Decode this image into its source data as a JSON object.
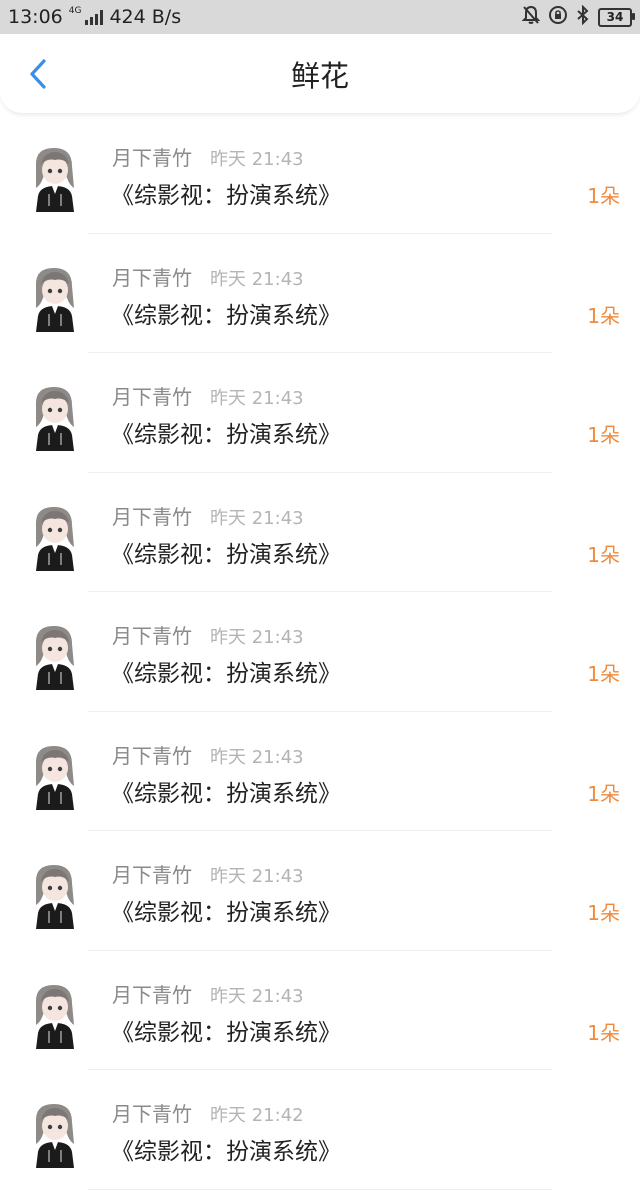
{
  "status_bar": {
    "time": "13:06",
    "network_tag": "4G",
    "speed": "424 B/s",
    "battery": "34"
  },
  "header": {
    "title": "鲜花"
  },
  "colors": {
    "accent_blue": "#3a8ee6",
    "amount_orange": "#f08a3e"
  },
  "records": [
    {
      "user": "月下青竹",
      "time": "昨天 21:43",
      "book": "《综影视：扮演系统》",
      "amount": "1朵"
    },
    {
      "user": "月下青竹",
      "time": "昨天 21:43",
      "book": "《综影视：扮演系统》",
      "amount": "1朵"
    },
    {
      "user": "月下青竹",
      "time": "昨天 21:43",
      "book": "《综影视：扮演系统》",
      "amount": "1朵"
    },
    {
      "user": "月下青竹",
      "time": "昨天 21:43",
      "book": "《综影视：扮演系统》",
      "amount": "1朵"
    },
    {
      "user": "月下青竹",
      "time": "昨天 21:43",
      "book": "《综影视：扮演系统》",
      "amount": "1朵"
    },
    {
      "user": "月下青竹",
      "time": "昨天 21:43",
      "book": "《综影视：扮演系统》",
      "amount": "1朵"
    },
    {
      "user": "月下青竹",
      "time": "昨天 21:43",
      "book": "《综影视：扮演系统》",
      "amount": "1朵"
    },
    {
      "user": "月下青竹",
      "time": "昨天 21:43",
      "book": "《综影视：扮演系统》",
      "amount": "1朵"
    },
    {
      "user": "月下青竹",
      "time": "昨天 21:42",
      "book": "《综影视：扮演系统》",
      "amount": ""
    }
  ]
}
